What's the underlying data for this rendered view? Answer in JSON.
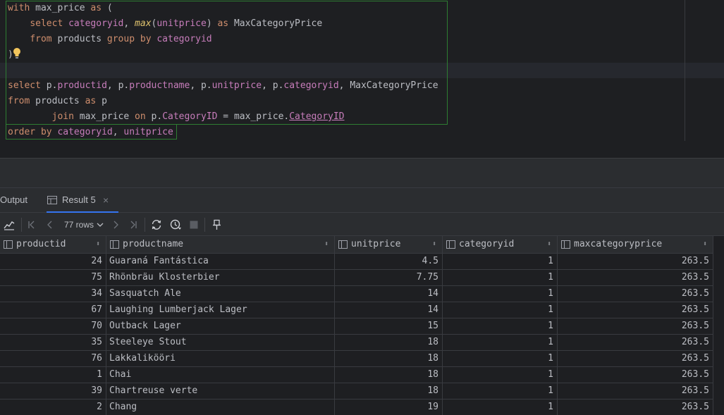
{
  "editor": {
    "lines": [
      "with max_price as (",
      "    select categoryid, max(unitprice) as MaxCategoryPrice",
      "    from products group by categoryid",
      ")",
      "",
      "select p.productid, p.productname, p.unitprice, p.categoryid, MaxCategoryPrice",
      "from products as p",
      "        join max_price on p.CategoryID = max_price.CategoryID",
      "order by categoryid, unitprice"
    ],
    "tokens": {
      "with": "with",
      "max_price": "max_price",
      "as": "as",
      "open_paren": "(",
      "select": "select",
      "categoryid": "categoryid",
      "comma": ",",
      "max": "max",
      "unitprice_paren": "(unitprice)",
      "MaxCategoryPrice": "MaxCategoryPrice",
      "from": "from",
      "products": "products",
      "group": "group",
      "by": "by",
      "close_paren": ")",
      "p": "p",
      "dot": ".",
      "productid": "productid",
      "productname": "productname",
      "unitprice": "unitprice",
      "join": "join",
      "on": "on",
      "CategoryID": "CategoryID",
      "eq": "=",
      "order": "order"
    }
  },
  "tabs": [
    {
      "label": "Output",
      "active": false
    },
    {
      "label": "Result 5",
      "active": true,
      "close": "×"
    }
  ],
  "toolbar": {
    "rows_label": "77 rows"
  },
  "grid": {
    "columns": [
      "productid",
      "productname",
      "unitprice",
      "categoryid",
      "maxcategoryprice"
    ],
    "sort_glyph": "⬍",
    "rows": [
      [
        "24",
        "Guaraná Fantástica",
        "4.5",
        "1",
        "263.5"
      ],
      [
        "75",
        "Rhönbräu Klosterbier",
        "7.75",
        "1",
        "263.5"
      ],
      [
        "34",
        "Sasquatch Ale",
        "14",
        "1",
        "263.5"
      ],
      [
        "67",
        "Laughing Lumberjack Lager",
        "14",
        "1",
        "263.5"
      ],
      [
        "70",
        "Outback Lager",
        "15",
        "1",
        "263.5"
      ],
      [
        "35",
        "Steeleye Stout",
        "18",
        "1",
        "263.5"
      ],
      [
        "76",
        "Lakkalikööri",
        "18",
        "1",
        "263.5"
      ],
      [
        "1",
        "Chai",
        "18",
        "1",
        "263.5"
      ],
      [
        "39",
        "Chartreuse verte",
        "18",
        "1",
        "263.5"
      ],
      [
        "2",
        "Chang",
        "19",
        "1",
        "263.5"
      ]
    ]
  },
  "colors": {
    "keyword": "#cf8e6d",
    "column": "#c77dbb",
    "function": "#e0c36e",
    "text": "#bcbec4",
    "accent": "#3574f0",
    "highlight_border": "#2e7d32"
  }
}
